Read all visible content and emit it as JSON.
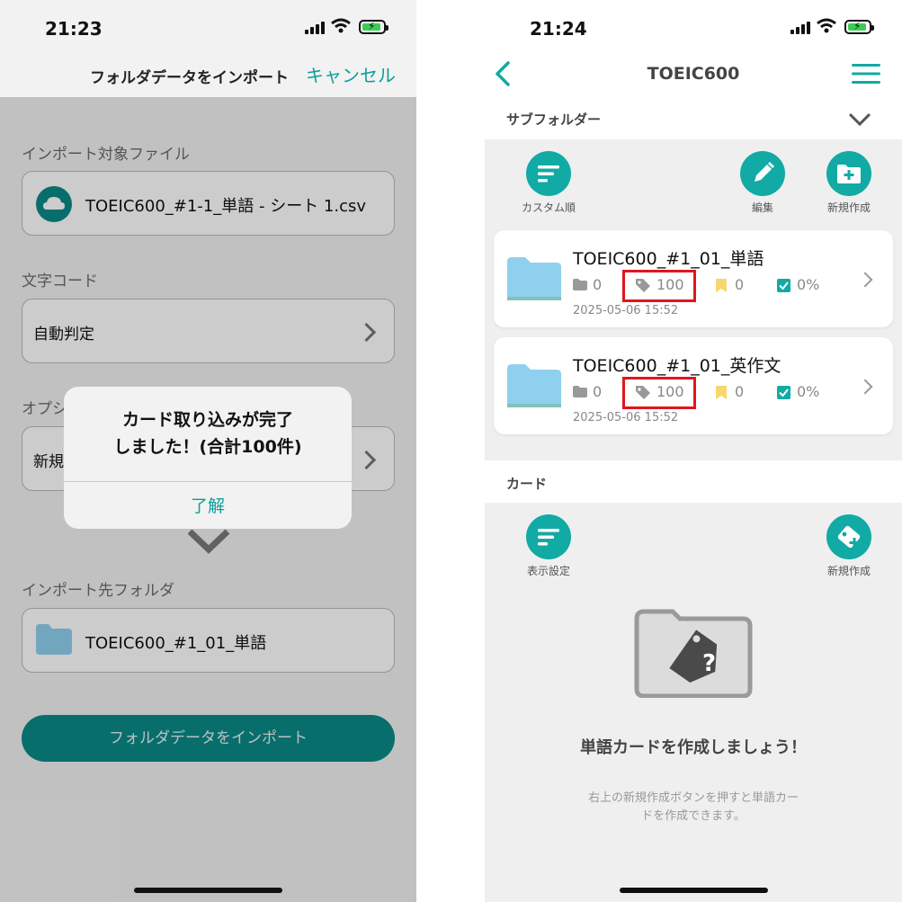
{
  "left": {
    "status": {
      "time": "21:23"
    },
    "header": {
      "title": "フォルダデータをインポート",
      "cancel_label": "キャンセル"
    },
    "import_file": {
      "label": "インポート対象ファイル",
      "value": "TOEIC600_#1-1_単語 - シート 1.csv",
      "icon": "cloud-icon"
    },
    "encoding": {
      "label": "文字コード",
      "value": "自動判定"
    },
    "option": {
      "label": "オプシ",
      "value": "新規"
    },
    "dest": {
      "label": "インポート先フォルダ",
      "value": "TOEIC600_#1_01_単語",
      "icon": "folder-icon"
    },
    "import_button": "フォルダデータをインポート",
    "alert": {
      "line1": "カード取り込みが完了",
      "line2": "しました！(合計100件)",
      "ok": "了解"
    }
  },
  "right": {
    "status": {
      "time": "21:24"
    },
    "nav": {
      "title": "TOEIC600"
    },
    "subfolder_section": "サブフォルダー",
    "subfolder_actions": {
      "custom_sort": "カスタム順",
      "edit": "編集",
      "new": "新規作成"
    },
    "folders": [
      {
        "name": "TOEIC600_#1_01_単語",
        "subfolders": "0",
        "cards": "100",
        "bookmarks": "0",
        "progress": "0%",
        "date": "2025-05-06 15:52"
      },
      {
        "name": "TOEIC600_#1_01_英作文",
        "subfolders": "0",
        "cards": "100",
        "bookmarks": "0",
        "progress": "0%",
        "date": "2025-05-06 15:52"
      }
    ],
    "card_section": "カード",
    "card_actions": {
      "display_settings": "表示設定",
      "new": "新規作成"
    },
    "empty": {
      "title": "単語カードを作成しましょう！",
      "sub1": "右上の新規作成ボタンを押すと単語カー",
      "sub2": "ドを作成できます。"
    }
  },
  "colors": {
    "accent": "#12aaa4",
    "highlight": "#e0161e",
    "folder": "#8fd0ee"
  }
}
